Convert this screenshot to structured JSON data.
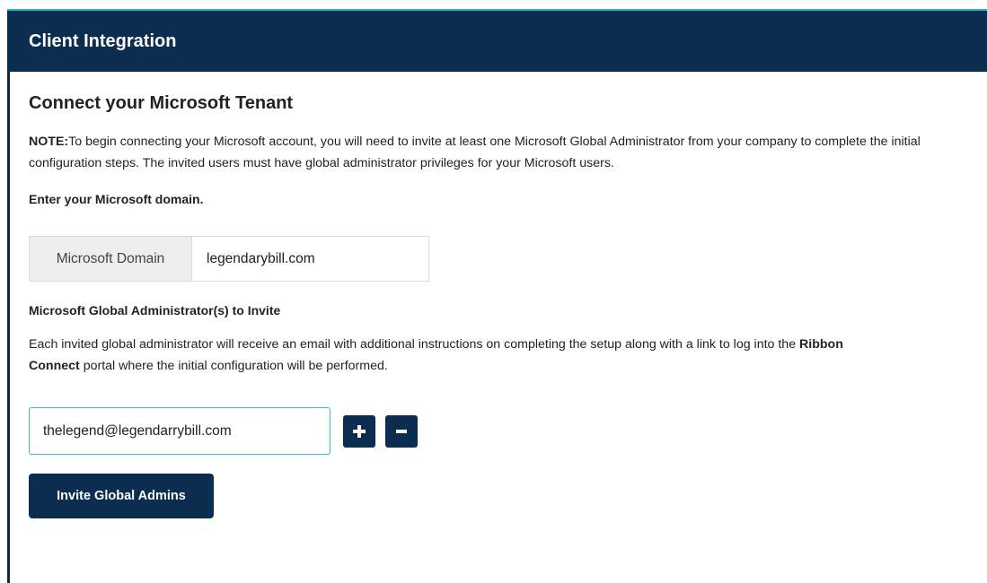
{
  "header": {
    "title": "Client Integration"
  },
  "main": {
    "section_title": "Connect your Microsoft Tenant",
    "note_prefix": "NOTE:",
    "note_text": "To begin connecting your Microsoft account, you will need to invite at least one Microsoft Global Administrator from your company to complete the initial configuration steps. The invited users must have global administrator privileges for your Microsoft users.",
    "domain_prompt": "Enter your Microsoft domain.",
    "domain_addon_label": "Microsoft Domain",
    "domain_value": "legendarybill.com",
    "admins_label": "Microsoft Global Administrator(s) to Invite",
    "admins_desc_part1": "Each invited global administrator will receive an email with additional instructions on completing the setup along with a link to log into the ",
    "admins_desc_bold": "Ribbon Connect",
    "admins_desc_part2": " portal where the initial configuration will be performed.",
    "admin_email_value": "thelegend@legendarrybill.com",
    "add_icon": "plus-icon",
    "remove_icon": "minus-icon",
    "invite_button_label": "Invite Global Admins"
  },
  "colors": {
    "header_bg": "#0b2d50",
    "accent": "#27b5c8",
    "input_focus_border": "#3fbcc8"
  }
}
